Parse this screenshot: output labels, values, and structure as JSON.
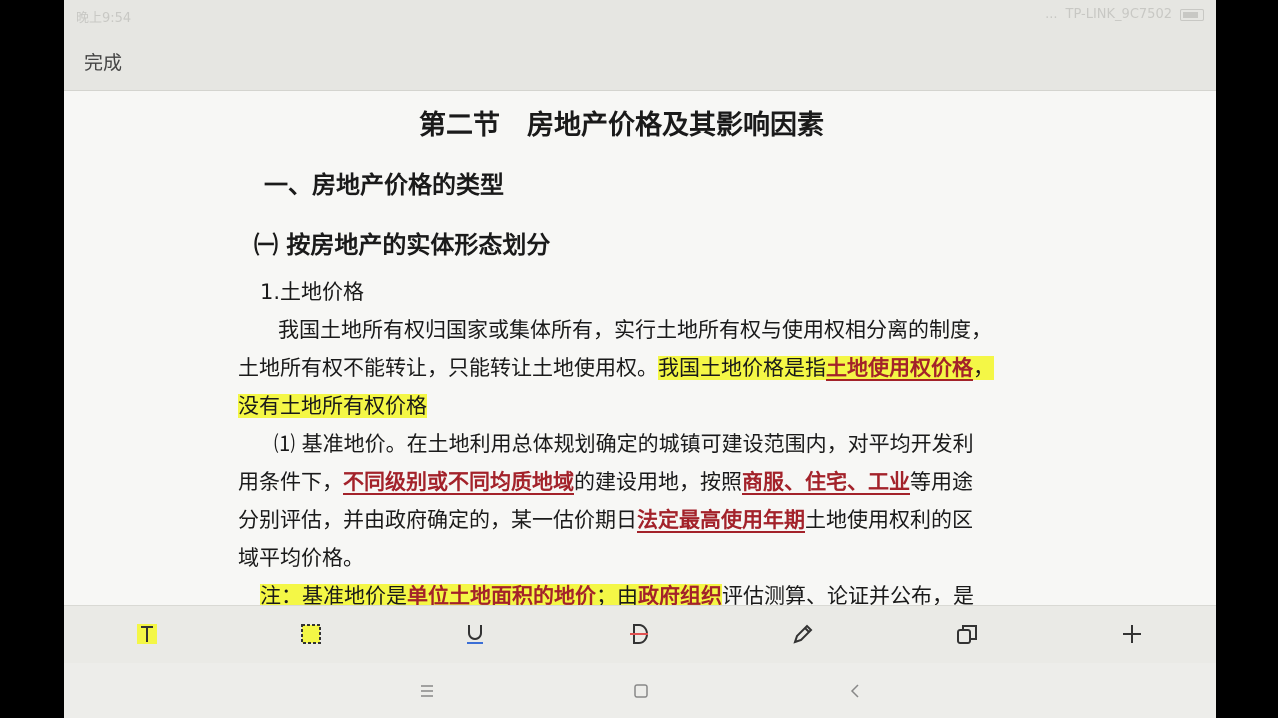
{
  "status": {
    "time": "晚上9:54",
    "dots": "...",
    "wifi": "TP-LINK_9C7502"
  },
  "topbar": {
    "done_label": "完成"
  },
  "doc": {
    "title": "第二节　房地产价格及其影响因素",
    "heading1": "一、房地产价格的类型",
    "heading2": "㈠ 按房地产的实体形态划分",
    "sub1": "1.土地价格",
    "p1_line1": "我国土地所有权归国家或集体所有，实行土地所有权与使用权相分离的制度，",
    "p1_line2_a": "土地所有权不能转让，只能转让土地使用权。",
    "p1_line2_b": "我国土地价格是指",
    "p1_line2_c": "土地使用权价格",
    "p1_line2_d": "，",
    "p1_line3": "没有土地所有权价格",
    "p2_line1": "⑴ 基准地价。在土地利用总体规划确定的城镇可建设范围内，对平均开发利",
    "p2_line2_a": "用条件下，",
    "p2_line2_b": "不同级别或不同均质地域",
    "p2_line2_c": "的建设用地，按照",
    "p2_line2_d": "商服、住宅、工业",
    "p2_line2_e": "等用途",
    "p2_line3_a": "分别评估，并由政府确定的，某一估价期日",
    "p2_line3_b": "法定最高使用年期",
    "p2_line3_c": "土地使用权利的区",
    "p2_line4": "域平均价格。",
    "note_a": "注：基准地价是",
    "note_b": "单位土地面积的地价",
    "note_c": "；由",
    "note_d": "政府组织",
    "note_e": "评估测算、论证并公布，是"
  },
  "toolbar": {
    "tools": [
      "highlight-text",
      "select-area",
      "underline",
      "strikethrough",
      "pen",
      "copy",
      "add"
    ],
    "highlight_color": "#f4f746",
    "accent_color": "#3b6fd6",
    "strike_color": "#e05050"
  },
  "navbar": {
    "buttons": [
      "menu",
      "home",
      "back"
    ]
  }
}
